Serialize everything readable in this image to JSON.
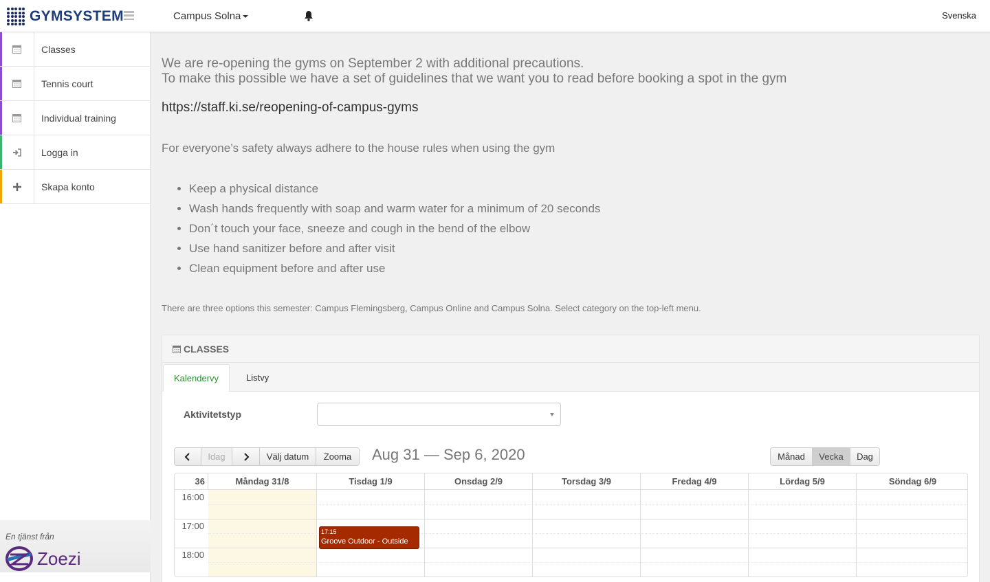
{
  "header": {
    "logo_text": "GYMSYSTEM",
    "campus": "Campus Solna",
    "language": "Svenska"
  },
  "sidebar": {
    "items": [
      {
        "label": "Classes",
        "icon": "calendar-icon",
        "color": "#8a4fd0"
      },
      {
        "label": "Tennis court",
        "icon": "calendar-icon",
        "color": "#8a4fd0"
      },
      {
        "label": "Individual training",
        "icon": "calendar-icon",
        "color": "#8a4fd0"
      },
      {
        "label": "Logga in",
        "icon": "sign-in-icon",
        "color": "#3cb371"
      },
      {
        "label": "Skapa konto",
        "icon": "plus-icon",
        "color": "#f0a500"
      }
    ],
    "footer_small": "En tjänst från",
    "footer_brand": "Zoezi"
  },
  "main": {
    "intro_line1": "We are re-opening the gyms on September 2 with additional precautions.",
    "intro_line2": "To make this possible we have a set of guidelines that we want you to read before booking a spot in the gym",
    "link": "https://staff.ki.se/reopening-of-campus-gyms",
    "safety_text": "For everyone’s safety always adhere to the house rules when using the gym",
    "rules": [
      "Keep a physical distance",
      "Wash hands frequently with soap and warm water for a minimum of 20 seconds",
      "Don´t touch your face, sneeze and cough in the bend of the elbow",
      "Use hand sanitizer before and after visit",
      "Clean equipment before and after use"
    ],
    "options_text": "There are three options this semester: Campus Flemingsberg, Campus Online and Campus Solna. Select category on the top-left menu."
  },
  "classes": {
    "title": "CLASSES",
    "tabs": [
      "Kalendervy",
      "Listvy"
    ],
    "filter_label": "Aktivitetstyp",
    "filter_value": "",
    "nav": {
      "today": "Idag",
      "pick_date": "Välj datum",
      "zoom": "Zooma"
    },
    "range": "Aug 31 — Sep 6, 2020",
    "views": [
      "Månad",
      "Vecka",
      "Dag"
    ],
    "active_view": "Vecka",
    "week_number": "36",
    "days": [
      "Måndag 31/8",
      "Tisdag 1/9",
      "Onsdag 2/9",
      "Torsdag 3/9",
      "Fredag 4/9",
      "Lördag 5/9",
      "Söndag 6/9"
    ],
    "times": [
      "16:00",
      "17:00",
      "18:00"
    ],
    "event": {
      "time": "17:15",
      "name": "Groove Outdoor - Outside",
      "color": "#a52a00"
    }
  }
}
